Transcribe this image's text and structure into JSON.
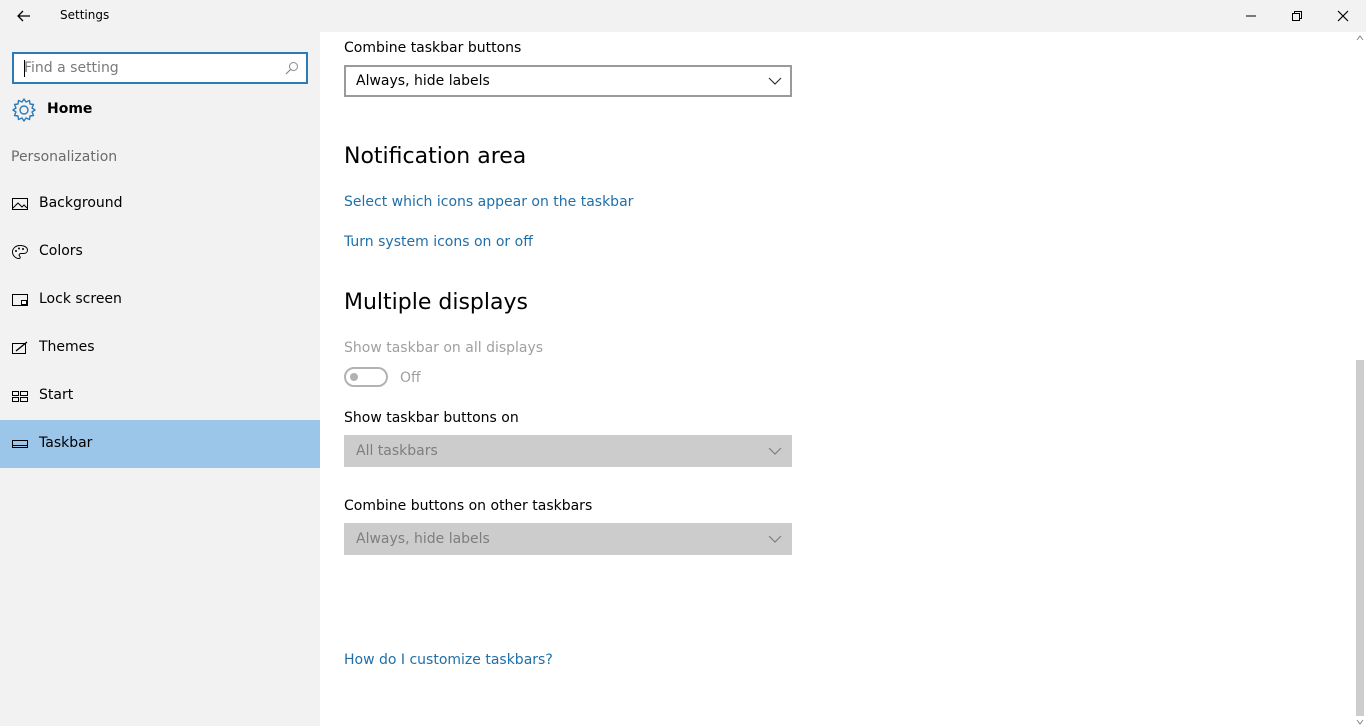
{
  "window": {
    "title": "Settings",
    "controls": [
      "minimize",
      "restore",
      "close"
    ]
  },
  "sidebar": {
    "search_placeholder": "Find a setting",
    "home_label": "Home",
    "section_label": "Personalization",
    "items": [
      {
        "label": "Background",
        "icon": "picture-icon"
      },
      {
        "label": "Colors",
        "icon": "palette-icon"
      },
      {
        "label": "Lock screen",
        "icon": "lock-screen-icon"
      },
      {
        "label": "Themes",
        "icon": "themes-icon"
      },
      {
        "label": "Start",
        "icon": "start-icon"
      },
      {
        "label": "Taskbar",
        "icon": "taskbar-icon",
        "selected": true
      }
    ]
  },
  "main": {
    "combine_label": "Combine taskbar buttons",
    "combine_value": "Always, hide labels",
    "notification_heading": "Notification area",
    "link_select_icons": "Select which icons appear on the taskbar",
    "link_system_icons": "Turn system icons on or off",
    "multiple_heading": "Multiple displays",
    "show_all_label": "Show taskbar on all displays",
    "show_all_state": "Off",
    "show_buttons_label": "Show taskbar buttons on",
    "show_buttons_value": "All taskbars",
    "combine_other_label": "Combine buttons on other taskbars",
    "combine_other_value": "Always, hide labels",
    "help_link": "How do I customize taskbars?"
  },
  "colors": {
    "accent": "#2b7bb9",
    "selected_bg": "#9bc5e9",
    "link": "#1f6fa8",
    "sidebar_bg": "#f2f2f2"
  }
}
